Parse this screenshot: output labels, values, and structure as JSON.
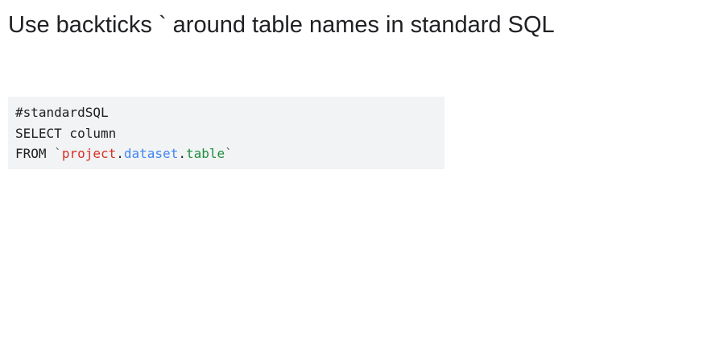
{
  "slide": {
    "title": "Use backticks ` around table names in standard SQL"
  },
  "code": {
    "line1": "#standardSQL",
    "line2": "SELECT column",
    "line3_keyword": "FROM ",
    "open_backtick": "`",
    "project": "project",
    "dot1": ".",
    "dataset": "dataset",
    "dot2": ".",
    "table": "table",
    "close_backtick": "`",
    "colors": {
      "project": "#d93025",
      "dataset": "#4285f4",
      "table": "#1e8e3e"
    }
  }
}
